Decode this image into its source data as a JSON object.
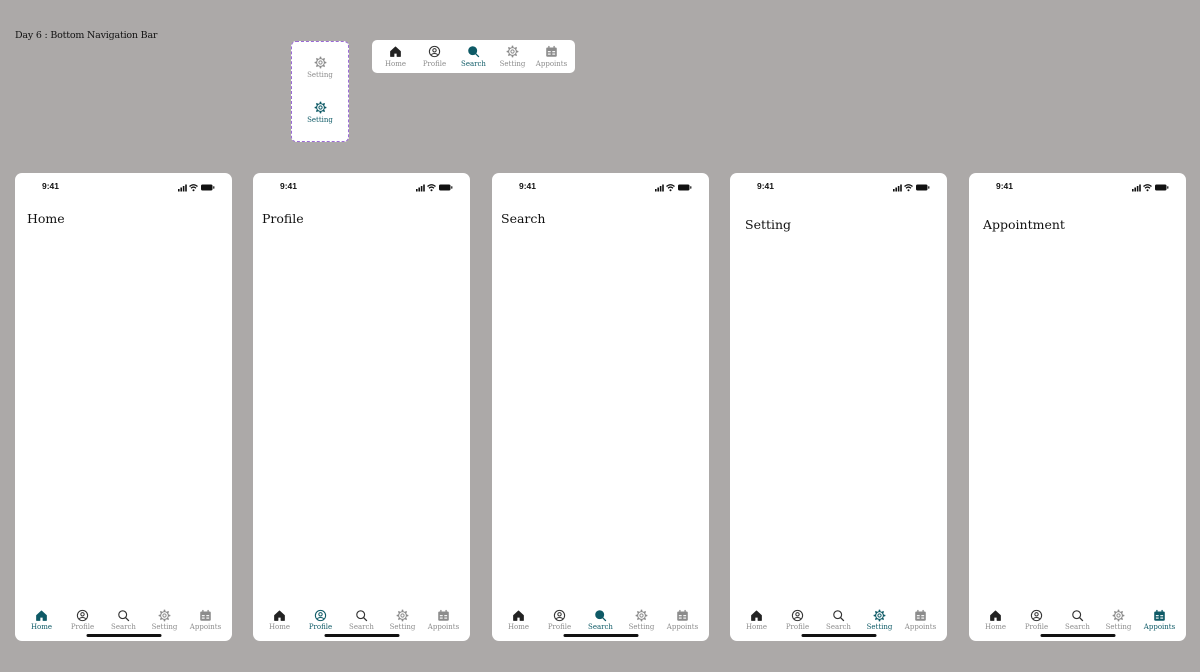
{
  "canvas_title": "Day 6 : Bottom Navigation Bar",
  "status_time": "9:41",
  "colors": {
    "active": "#0e5a66",
    "inactive": "#8c8c8c",
    "background": "#aca9a8"
  },
  "variant": {
    "labels": [
      "Setting",
      "Setting"
    ]
  },
  "nav_component": {
    "items": [
      {
        "label": "Home",
        "icon": "home-icon"
      },
      {
        "label": "Profile",
        "icon": "profile-icon"
      },
      {
        "label": "Search",
        "icon": "search-icon"
      },
      {
        "label": "Setting",
        "icon": "gear-icon"
      },
      {
        "label": "Appoints",
        "icon": "calendar-icon"
      }
    ],
    "active_index": 2
  },
  "screens": [
    {
      "title": "Home",
      "active_index": 0
    },
    {
      "title": "Profile",
      "active_index": 1
    },
    {
      "title": "Search",
      "active_index": 2
    },
    {
      "title": "Setting",
      "active_index": 3
    },
    {
      "title": "Appointment",
      "active_index": 4
    }
  ]
}
